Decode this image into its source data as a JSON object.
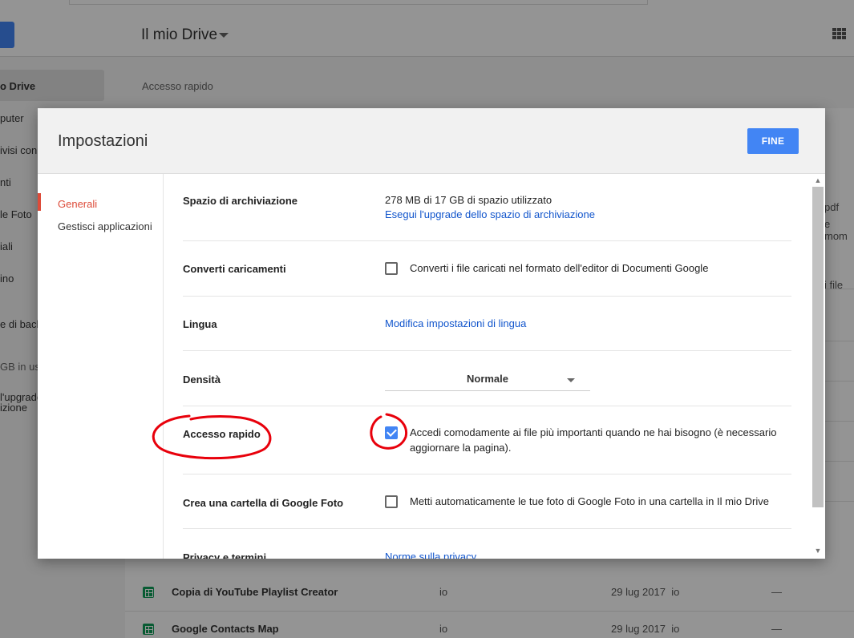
{
  "background": {
    "title": "Il mio Drive",
    "section_title": "Accesso rapido",
    "sidebar_items": [
      "o Drive",
      "puter",
      "ivisi con",
      "nti",
      "le Foto",
      "iali",
      "ino",
      "e di back",
      "GB in us",
      "l'upgrade",
      "izione"
    ],
    "right_texts": [
      "pdf",
      "e mom",
      "i file"
    ],
    "files": [
      {
        "name": "Copia di YouTube Playlist Creator",
        "owner": "io",
        "date": "29 lug 2017",
        "date_owner": "io",
        "size": "—"
      },
      {
        "name": "Google Contacts Map",
        "owner": "io",
        "date": "29 lug 2017",
        "date_owner": "io",
        "size": "—"
      }
    ]
  },
  "dialog": {
    "title": "Impostazioni",
    "done_label": "FINE",
    "nav": [
      {
        "label": "Generali",
        "active": true
      },
      {
        "label": "Gestisci applicazioni",
        "active": false
      }
    ],
    "settings": {
      "storage": {
        "label": "Spazio di archiviazione",
        "usage": "278 MB di 17 GB di spazio utilizzato",
        "upgrade_link": "Esegui l'upgrade dello spazio di archiviazione"
      },
      "convert": {
        "label": "Converti caricamenti",
        "checked": false,
        "text": "Converti i file caricati nel formato dell'editor di Documenti Google"
      },
      "language": {
        "label": "Lingua",
        "link": "Modifica impostazioni di lingua"
      },
      "density": {
        "label": "Densità",
        "value": "Normale"
      },
      "quick_access": {
        "label": "Accesso rapido",
        "checked": true,
        "text": "Accedi comodamente ai file più importanti quando ne hai bisogno (è necessario aggiornare la pagina)."
      },
      "photos_folder": {
        "label": "Crea una cartella di Google Foto",
        "checked": false,
        "text": "Metti automaticamente le tue foto di Google Foto in una cartella in Il mio Drive"
      },
      "privacy": {
        "label": "Privacy e termini",
        "link": "Norme sulla privacy"
      }
    }
  },
  "colors": {
    "accent": "#4285f4",
    "nav_active": "#dd4b39",
    "link": "#1155cc",
    "annotation": "#e8000b"
  },
  "icons": [
    "chevron-down-icon",
    "apps-grid-icon",
    "spreadsheet-icon",
    "checkbox-icon",
    "scroll-up-icon",
    "scroll-down-icon"
  ]
}
